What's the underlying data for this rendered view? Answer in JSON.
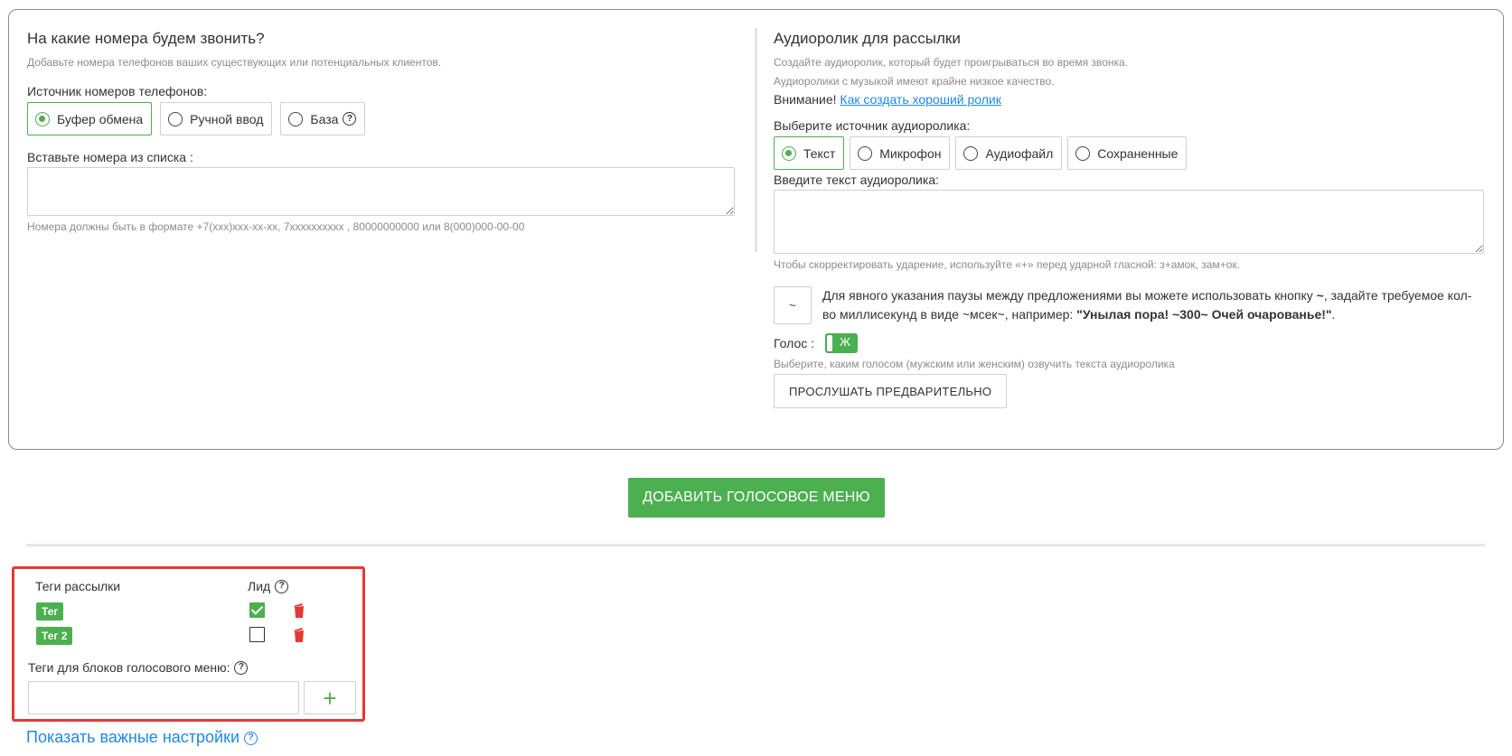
{
  "left": {
    "title": "На какие номера будем звонить?",
    "subtitle": "Добавьте номера телефонов ваших существующих или потенциальных клиентов.",
    "source_label": "Источник номеров телефонов:",
    "source_options": [
      "Буфер обмена",
      "Ручной ввод",
      "База"
    ],
    "paste_label": "Вставьте номера из списка :",
    "format_hint": "Номера должны быть в формате +7(xxx)xxx-xx-xx, 7xxxxxxxxxx , 80000000000 или 8(000)000-00-00"
  },
  "right": {
    "title": "Аудиоролик для рассылки",
    "hint1": "Создайте аудиоролик, который будет проигрываться во время звонка.",
    "hint2": "Аудиоролики с музыкой имеют крайне низкое качество.",
    "attention": "Внимание!",
    "attention_link": "Как создать хороший ролик",
    "source_label": "Выберите источник аудиоролика:",
    "source_options": [
      "Текст",
      "Микрофон",
      "Аудиофайл",
      "Сохраненные"
    ],
    "text_label": "Введите текст аудиоролика:",
    "stress_hint": "Чтобы скорректировать ударение, используйте «+» перед ударной гласной: з+амок, зам+ок.",
    "tilde_button": "~",
    "pause_text_1": "Для явного указания паузы между предложениями вы можете использовать кнопку",
    "pause_text_tilde": "~",
    "pause_text_2": ", задайте требуемое кол-во миллисекунд в виде ~мсек~, например:",
    "pause_example": "\"Унылая пора! ~300~ Очей очарованье!\"",
    "pause_end": ".",
    "voice_label": "Голос :",
    "voice_toggle": "Ж",
    "voice_hint": "Выберите, каким голосом (мужским или женским) озвучить текста аудиоролика",
    "preview_button": "ПРОСЛУШАТЬ ПРЕДВАРИТЕЛЬНО"
  },
  "add_voice_menu_button": "ДОБАВИТЬ ГОЛОСОВОЕ МЕНЮ",
  "tags": {
    "header_tags": "Теги рассылки",
    "header_lead": "Лид",
    "rows": [
      {
        "name": "Тег",
        "lead": true
      },
      {
        "name": "Тег 2",
        "lead": false
      }
    ],
    "voice_menu_tags_label": "Теги для блоков голосового меню:",
    "add_symbol": "+"
  },
  "show_settings": "Показать важные настройки",
  "help_symbol": "?",
  "colors": {
    "accent": "#4caf50",
    "link": "#1e88e5",
    "highlight": "#e53935",
    "delete": "#e53935"
  },
  "icons": {
    "help": "help-icon",
    "delete": "trash-icon",
    "add": "plus-icon",
    "check": "check-icon"
  }
}
